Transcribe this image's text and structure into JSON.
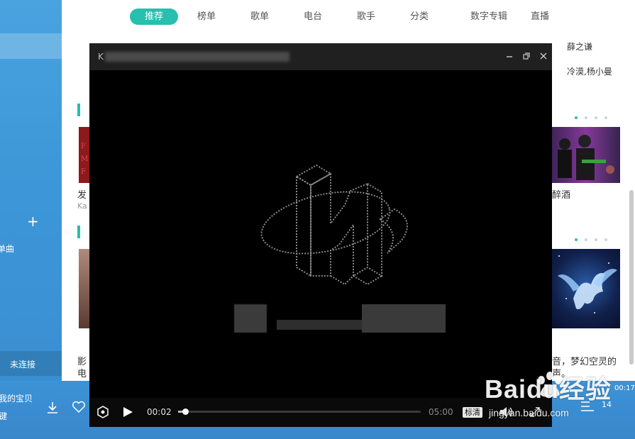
{
  "nav": {
    "tabs": [
      {
        "label": "推荐"
      },
      {
        "label": "榜单"
      },
      {
        "label": "歌单"
      },
      {
        "label": "电台"
      },
      {
        "label": "歌手"
      },
      {
        "label": "分类"
      },
      {
        "label": "数字专辑"
      },
      {
        "label": "直播"
      }
    ]
  },
  "sidebar": {
    "item_label": "单曲",
    "connection_status": "未连接"
  },
  "songlist": {
    "artist_1": "薛之谦",
    "artist_2": "冷漠,杨小曼"
  },
  "sections": {
    "card_1": {
      "title": "发",
      "subtitle": "Ka"
    },
    "card_2": {
      "title": "醉酒"
    },
    "card_3": {
      "title": "影",
      "subtitle": "电"
    },
    "card_4": {
      "line1": "音，梦幻空灵的",
      "line2": "声。"
    }
  },
  "player_bar": {
    "song_title": "我的宝贝",
    "artist": "键",
    "elapsed": "00:17",
    "count": "14"
  },
  "video_window": {
    "title_prefix": "K",
    "controls": {
      "current_time": "00:02",
      "total_time": "05:00",
      "quality_label": "标清"
    },
    "progress": 0.03
  },
  "watermark": {
    "main": "Baidu经验",
    "sub": "jingyan.baidu.com"
  },
  "colors": {
    "accent": "#27bfae",
    "sidebar_blue": "#3d97d8",
    "video_bg": "#000000"
  }
}
